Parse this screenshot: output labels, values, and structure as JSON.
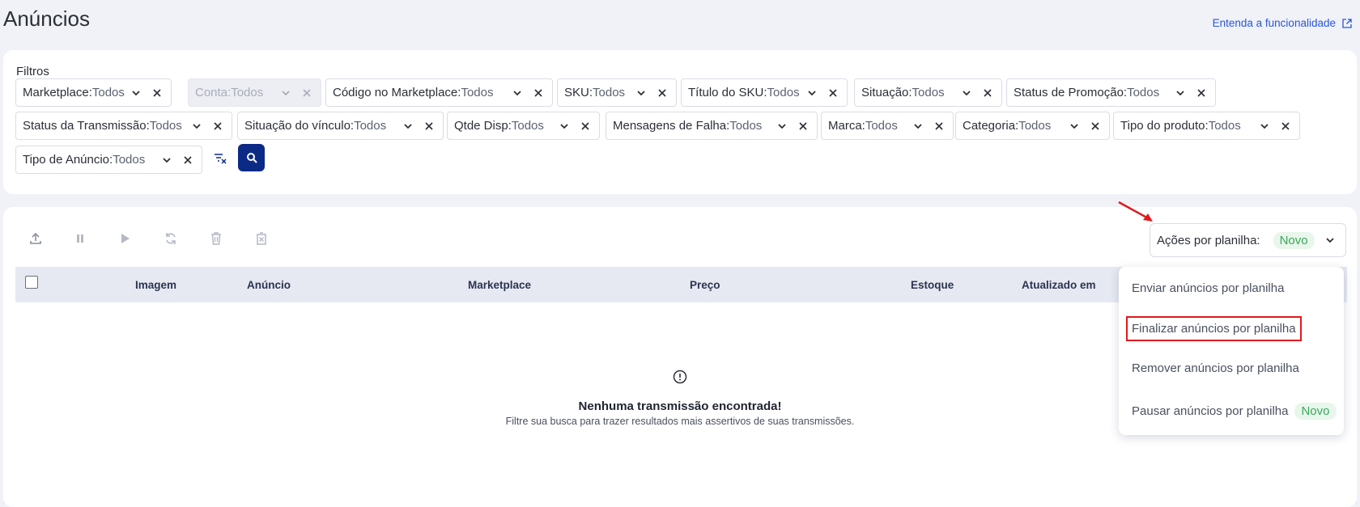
{
  "header": {
    "title": "Anúncios",
    "help_link": "Entenda a funcionalidade"
  },
  "filters": {
    "title": "Filtros",
    "chips": [
      {
        "label": "Marketplace:",
        "value": " Todos",
        "disabled": false
      },
      {
        "label": "Conta:",
        "value": " Todos",
        "disabled": true
      },
      {
        "label": "Código no Marketplace:",
        "value": "Todos",
        "disabled": false
      },
      {
        "label": "SKU:",
        "value": "Todos",
        "disabled": false
      },
      {
        "label": "Título do SKU:",
        "value": "Todos",
        "disabled": false
      },
      {
        "label": "Situação:",
        "value": "Todos",
        "disabled": false
      },
      {
        "label": "Status de Promoção:",
        "value": "Todos",
        "disabled": false
      },
      {
        "label": "Status da Transmissão:",
        "value": "Todos",
        "disabled": false
      },
      {
        "label": "Situação do vínculo:",
        "value": "Todos",
        "disabled": false
      },
      {
        "label": "Qtde Disp:",
        "value": "Todos",
        "disabled": false
      },
      {
        "label": "Mensagens de Falha:",
        "value": " Todos",
        "disabled": false
      },
      {
        "label": "Marca:",
        "value": "Todos",
        "disabled": false
      },
      {
        "label": "Categoria:",
        "value": "Todos",
        "disabled": false
      },
      {
        "label": "Tipo do produto:",
        "value": "Todos",
        "disabled": false
      },
      {
        "label": "Tipo de Anúncio:",
        "value": "Todos",
        "disabled": false
      }
    ]
  },
  "toolbar": {
    "icons": [
      "upload-icon",
      "pause-icon",
      "play-icon",
      "refresh-icon",
      "trash-icon",
      "delete-box-icon"
    ],
    "actions_label": "Ações por planilha:",
    "actions_badge": "Novo"
  },
  "table": {
    "columns": [
      "Imagem",
      "Anúncio",
      "Marketplace",
      "Preço",
      "Estoque",
      "Atualizado em"
    ]
  },
  "empty_state": {
    "title": "Nenhuma transmissão encontrada!",
    "subtitle": "Filtre sua busca para trazer resultados mais assertivos de suas transmissões."
  },
  "dropdown": {
    "items": [
      {
        "label": "Enviar anúncios por planilha"
      },
      {
        "label": "Finalizar anúncios por planilha"
      },
      {
        "label": "Remover anúncios por planilha"
      },
      {
        "label": "Pausar anúncios por planilha",
        "badge": "Novo"
      }
    ]
  },
  "colors": {
    "primary": "#0b2a86",
    "link": "#2855d8",
    "badge_bg": "#e8f6ec",
    "badge_text": "#3aa85a",
    "highlight": "#e0191e"
  }
}
